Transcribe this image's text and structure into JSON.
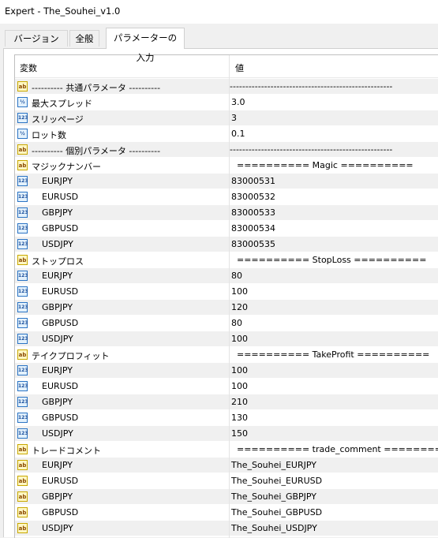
{
  "window": {
    "title": "Expert - The_Souhei_v1.0"
  },
  "tabs": [
    {
      "label": "バージョン情報"
    },
    {
      "label": "全般"
    },
    {
      "label": "パラメーターの入力"
    }
  ],
  "grid": {
    "header": {
      "variable": "変数",
      "value": "値"
    },
    "rows": [
      {
        "icon": "ab",
        "name": "----------    共通パラメータ    ----------",
        "value": "----------------------------------------------------"
      },
      {
        "icon": "half",
        "name": "最大スプレッド",
        "value": "3.0"
      },
      {
        "icon": "123",
        "name": "スリッページ",
        "value": "3"
      },
      {
        "icon": "half",
        "name": "ロット数",
        "value": "0.1"
      },
      {
        "icon": "ab",
        "name": "----------    個別パラメータ    ----------",
        "value": "----------------------------------------------------"
      },
      {
        "icon": "ab",
        "name": "マジックナンバー",
        "value": "  ========== Magic =========="
      },
      {
        "icon": "123",
        "name": "EURJPY",
        "value": "83000531"
      },
      {
        "icon": "123",
        "name": "EURUSD",
        "value": "83000532"
      },
      {
        "icon": "123",
        "name": "GBPJPY",
        "value": "83000533"
      },
      {
        "icon": "123",
        "name": "GBPUSD",
        "value": "83000534"
      },
      {
        "icon": "123",
        "name": "USDJPY",
        "value": "83000535"
      },
      {
        "icon": "ab",
        "name": "ストップロス",
        "value": "  ========== StopLoss =========="
      },
      {
        "icon": "123",
        "name": "EURJPY",
        "value": "80"
      },
      {
        "icon": "123",
        "name": "EURUSD",
        "value": "100"
      },
      {
        "icon": "123",
        "name": "GBPJPY",
        "value": "120"
      },
      {
        "icon": "123",
        "name": "GBPUSD",
        "value": "80"
      },
      {
        "icon": "123",
        "name": "USDJPY",
        "value": "100"
      },
      {
        "icon": "ab",
        "name": "テイクプロフィット",
        "value": "  ========== TakeProfit =========="
      },
      {
        "icon": "123",
        "name": "EURJPY",
        "value": "100"
      },
      {
        "icon": "123",
        "name": "EURUSD",
        "value": "100"
      },
      {
        "icon": "123",
        "name": "GBPJPY",
        "value": "210"
      },
      {
        "icon": "123",
        "name": "GBPUSD",
        "value": "130"
      },
      {
        "icon": "123",
        "name": "USDJPY",
        "value": "150"
      },
      {
        "icon": "ab",
        "name": "トレードコメント",
        "value": "  ========== trade_comment =========="
      },
      {
        "icon": "ab",
        "name": "EURJPY",
        "value": "The_Souhei_EURJPY"
      },
      {
        "icon": "ab",
        "name": "EURUSD",
        "value": "The_Souhei_EURUSD"
      },
      {
        "icon": "ab",
        "name": "GBPJPY",
        "value": "The_Souhei_GBPJPY"
      },
      {
        "icon": "ab",
        "name": "GBPUSD",
        "value": "The_Souhei_GBPUSD"
      },
      {
        "icon": "ab",
        "name": "USDJPY",
        "value": "The_Souhei_USDJPY"
      }
    ]
  },
  "icons": {
    "ab": "ab",
    "123": "123",
    "half": "½"
  }
}
